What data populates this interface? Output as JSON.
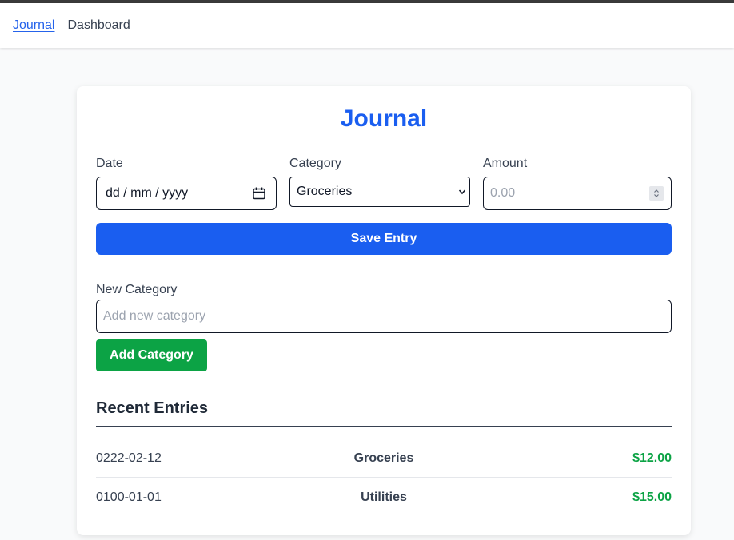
{
  "nav": {
    "items": [
      {
        "label": "Journal",
        "active": true
      },
      {
        "label": "Dashboard",
        "active": false
      }
    ]
  },
  "journal": {
    "title": "Journal",
    "date": {
      "label": "Date",
      "value": "dd / mm / yyyy"
    },
    "category": {
      "label": "Category",
      "selected": "Groceries"
    },
    "amount": {
      "label": "Amount",
      "placeholder": "0.00"
    },
    "save_label": "Save Entry"
  },
  "new_category": {
    "label": "New Category",
    "placeholder": "Add new category",
    "add_label": "Add Category"
  },
  "recent": {
    "title": "Recent Entries",
    "entries": [
      {
        "date": "0222-02-12",
        "category": "Groceries",
        "amount": "$12.00"
      },
      {
        "date": "0100-01-01",
        "category": "Utilities",
        "amount": "$15.00"
      }
    ]
  },
  "colors": {
    "primary": "#1a5ef0",
    "success": "#0ca345",
    "text": "#374151"
  },
  "icons": {
    "calendar": "calendar-icon",
    "dropdown": "chevron-down-icon",
    "spinner": "number-spinner-icon"
  }
}
